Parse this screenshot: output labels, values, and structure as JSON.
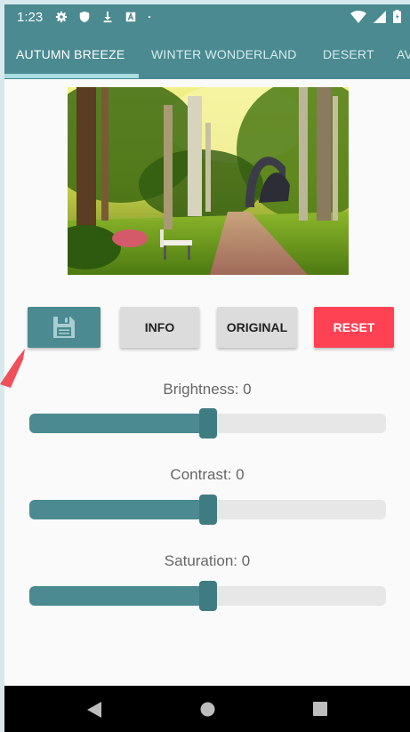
{
  "status": {
    "time": "1:23",
    "icons": [
      "gear-icon",
      "shield-icon",
      "download-icon",
      "font-a-icon",
      "dot-icon"
    ],
    "right_icons": [
      "wifi-icon",
      "signal-icon",
      "battery-icon"
    ]
  },
  "tabs": [
    {
      "label": "AUTUMN BREEZE",
      "active": true
    },
    {
      "label": "WINTER WONDERLAND",
      "active": false
    },
    {
      "label": "DESERT",
      "active": false
    },
    {
      "label": "AV",
      "active": false
    }
  ],
  "image": {
    "subject": "forest-path-photo"
  },
  "buttons": {
    "save_icon": "floppy-disk-icon",
    "info_label": "INFO",
    "original_label": "ORIGINAL",
    "reset_label": "RESET"
  },
  "sliders": [
    {
      "label": "Brightness: 0",
      "value_fraction": 0.5
    },
    {
      "label": "Contrast: 0",
      "value_fraction": 0.5
    },
    {
      "label": "Saturation: 0",
      "value_fraction": 0.5
    }
  ],
  "colors": {
    "primary": "#4a8a90",
    "accent": "#ff4154",
    "indicator": "#a9dde2"
  }
}
